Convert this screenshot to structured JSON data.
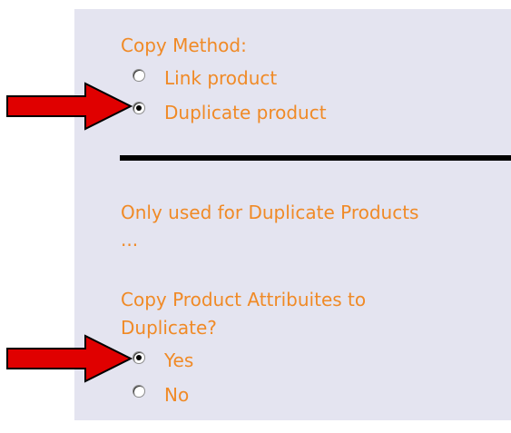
{
  "copy_method": {
    "heading": "Copy Method:",
    "options": [
      {
        "label": "Link product",
        "selected": false
      },
      {
        "label": "Duplicate product",
        "selected": true
      }
    ]
  },
  "duplicate_note": {
    "line1": "Only used for Duplicate Products",
    "line2": "..."
  },
  "copy_attributes": {
    "heading_line1": "Copy Product Attribuites to",
    "heading_line2": "Duplicate?",
    "options": [
      {
        "label": "Yes",
        "selected": true
      },
      {
        "label": "No",
        "selected": false
      }
    ]
  },
  "colors": {
    "text": "#f08a26",
    "panel_bg": "#e4e4f0",
    "arrow_fill": "#e00000",
    "arrow_outline": "#000000"
  }
}
